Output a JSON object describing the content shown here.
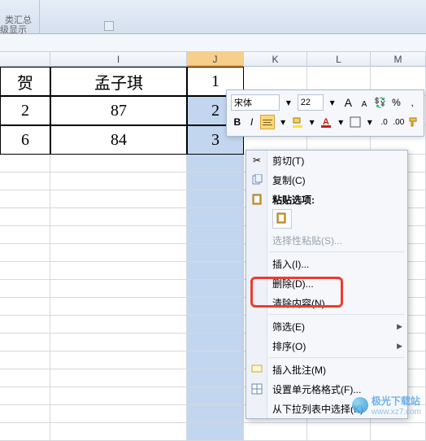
{
  "ribbon": {
    "group1_label": "类汇总",
    "group2_label": "级显示"
  },
  "columns": [
    {
      "label": "",
      "width": 62,
      "selected": false
    },
    {
      "label": "I",
      "width": 168,
      "selected": false
    },
    {
      "label": "J",
      "width": 70,
      "selected": true
    },
    {
      "label": "K",
      "width": 78,
      "selected": false
    },
    {
      "label": "L",
      "width": 78,
      "selected": false
    },
    {
      "label": "M",
      "width": 68,
      "selected": false
    }
  ],
  "data_rows": [
    {
      "h": 36,
      "cells": [
        "贺",
        "孟子琪",
        "1",
        "",
        "",
        ""
      ]
    },
    {
      "h": 36,
      "cells": [
        "2",
        "87",
        "2",
        "",
        "",
        ""
      ]
    },
    {
      "h": 36,
      "cells": [
        "6",
        "84",
        "3",
        "",
        "",
        ""
      ]
    }
  ],
  "mini_toolbar": {
    "font_name": "宋体",
    "font_size": "22",
    "grow_font": "A",
    "shrink_font": "A",
    "percent": "%",
    "comma": ",",
    "bold": "B",
    "italic": "I"
  },
  "context_menu": {
    "cut": "剪切(T)",
    "copy": "复制(C)",
    "paste_options": "粘贴选项:",
    "paste_special": "选择性粘贴(S)...",
    "insert": "插入(I)...",
    "delete": "删除(D)...",
    "clear": "清除内容(N)",
    "filter": "筛选(E)",
    "sort": "排序(O)",
    "insert_comment": "插入批注(M)",
    "format_cells": "设置单元格格式(F)...",
    "pick_from_list": "从下拉列表中选择(K)"
  },
  "watermark": {
    "text": "极光下载站",
    "url": "www.xz7.com"
  }
}
